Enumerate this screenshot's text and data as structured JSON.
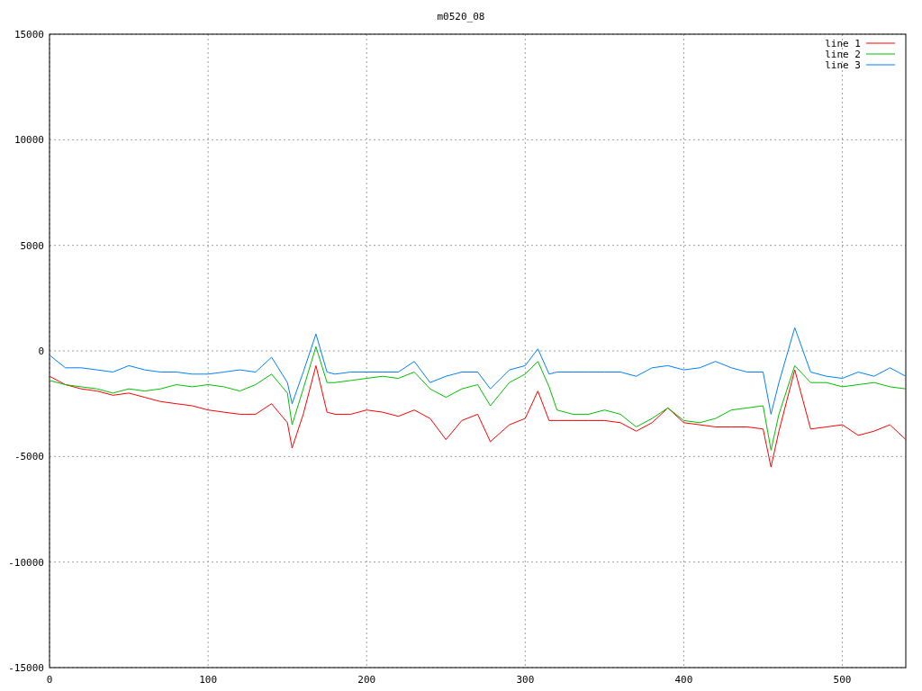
{
  "chart_data": {
    "type": "line",
    "title": "m0520_08",
    "xlim": [
      0,
      540
    ],
    "ylim": [
      -15000,
      15000
    ],
    "xticks": [
      0,
      100,
      200,
      300,
      400,
      500
    ],
    "yticks": [
      -15000,
      -10000,
      -5000,
      0,
      5000,
      10000,
      15000
    ],
    "grid": true,
    "legend": true,
    "x": [
      0,
      10,
      20,
      30,
      40,
      50,
      60,
      70,
      80,
      90,
      100,
      110,
      120,
      130,
      140,
      150,
      153,
      160,
      168,
      175,
      180,
      190,
      200,
      210,
      220,
      230,
      240,
      250,
      260,
      270,
      278,
      290,
      300,
      308,
      315,
      320,
      330,
      340,
      350,
      360,
      370,
      380,
      390,
      400,
      410,
      420,
      430,
      440,
      450,
      455,
      460,
      470,
      480,
      490,
      500,
      510,
      520,
      530,
      540
    ],
    "series": [
      {
        "name": "line 1",
        "color": "#ff0000",
        "values": [
          -1200,
          -1600,
          -1800,
          -1900,
          -2100,
          -2000,
          -2200,
          -2400,
          -2500,
          -2600,
          -2800,
          -2900,
          -3000,
          -3000,
          -2500,
          -3400,
          -4600,
          -3000,
          -700,
          -2900,
          -3000,
          -3000,
          -2800,
          -2900,
          -3100,
          -2800,
          -3200,
          -4200,
          -3300,
          -3000,
          -4300,
          -3500,
          -3200,
          -1900,
          -3300,
          -3300,
          -3300,
          -3300,
          -3300,
          -3400,
          -3800,
          -3400,
          -2700,
          -3400,
          -3500,
          -3600,
          -3600,
          -3600,
          -3700,
          -5500,
          -3800,
          -900,
          -3700,
          -3600,
          -3500,
          -4000,
          -3800,
          -3500,
          -4200
        ]
      },
      {
        "name": "line 2",
        "color": "#00c000",
        "values": [
          -1400,
          -1600,
          -1700,
          -1800,
          -2000,
          -1800,
          -1900,
          -1800,
          -1600,
          -1700,
          -1600,
          -1700,
          -1900,
          -1600,
          -1100,
          -2000,
          -3500,
          -1800,
          200,
          -1500,
          -1500,
          -1400,
          -1300,
          -1200,
          -1300,
          -1000,
          -1800,
          -2200,
          -1800,
          -1600,
          -2600,
          -1500,
          -1100,
          -500,
          -1700,
          -2800,
          -3000,
          -3000,
          -2800,
          -3000,
          -3600,
          -3200,
          -2700,
          -3300,
          -3400,
          -3200,
          -2800,
          -2700,
          -2600,
          -4700,
          -3000,
          -700,
          -1500,
          -1500,
          -1700,
          -1600,
          -1500,
          -1700,
          -1800
        ]
      },
      {
        "name": "line 3",
        "color": "#0080ff",
        "values": [
          -200,
          -800,
          -800,
          -900,
          -1000,
          -700,
          -900,
          -1000,
          -1000,
          -1100,
          -1100,
          -1000,
          -900,
          -1000,
          -300,
          -1500,
          -2500,
          -1000,
          800,
          -1000,
          -1100,
          -1000,
          -1000,
          -1000,
          -1000,
          -500,
          -1500,
          -1200,
          -1000,
          -1000,
          -1800,
          -900,
          -700,
          100,
          -1100,
          -1000,
          -1000,
          -1000,
          -1000,
          -1000,
          -1200,
          -800,
          -700,
          -900,
          -800,
          -500,
          -800,
          -1000,
          -1000,
          -3000,
          -1500,
          1100,
          -1000,
          -1200,
          -1300,
          -1000,
          -1200,
          -800,
          -1200
        ]
      }
    ]
  }
}
